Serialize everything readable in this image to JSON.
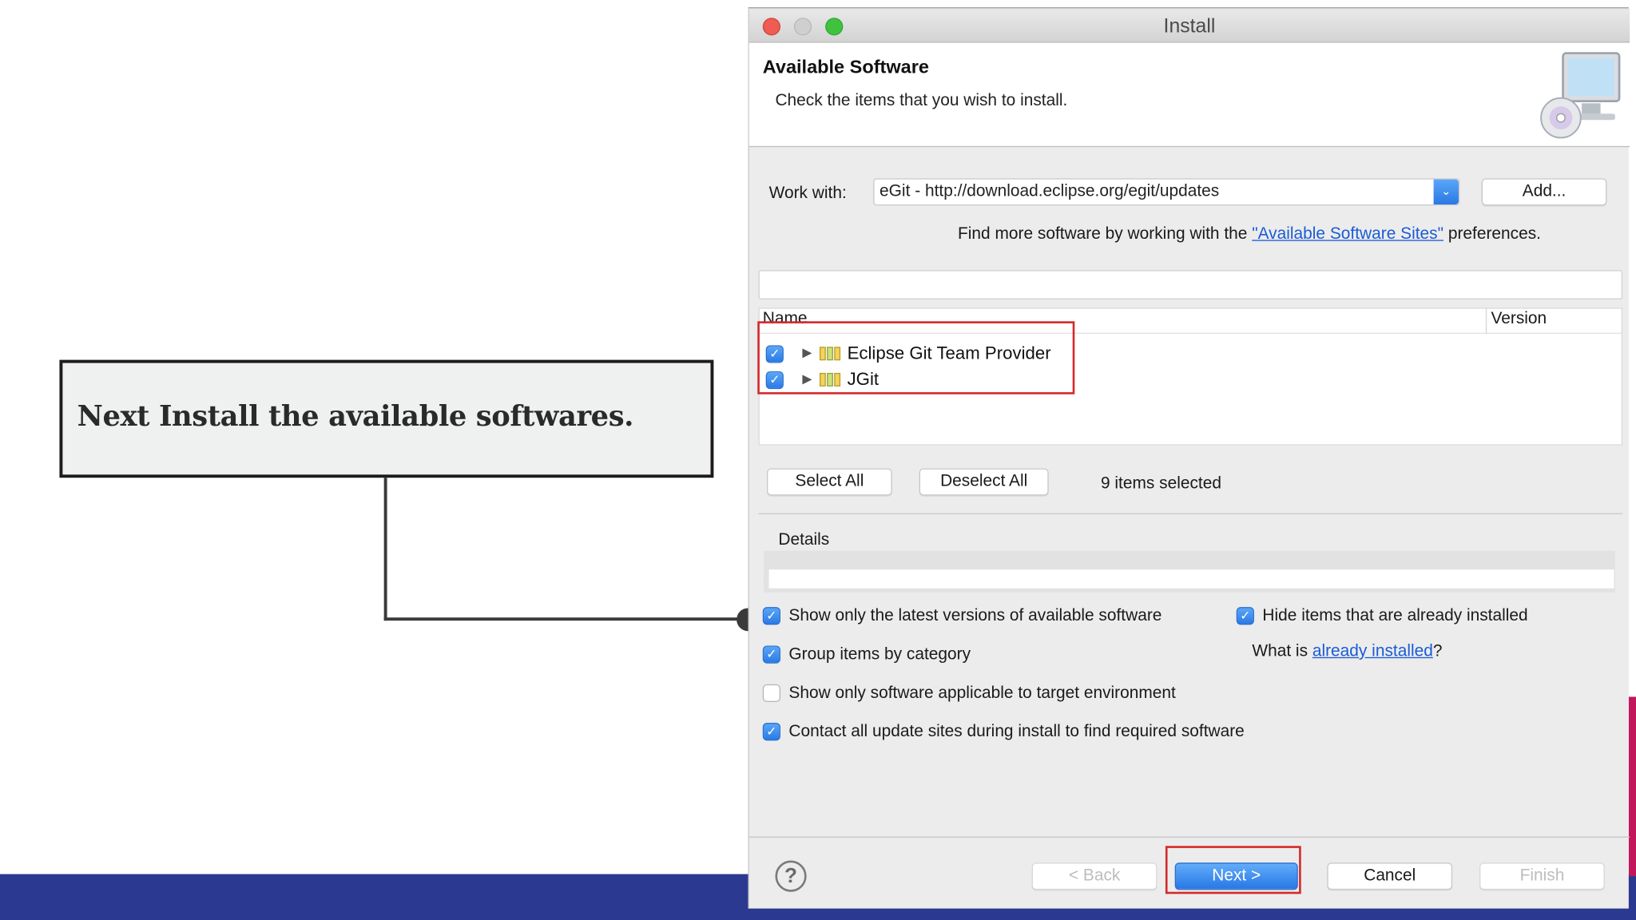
{
  "callout": {
    "text": "Next Install the available softwares."
  },
  "window": {
    "title": "Install"
  },
  "header": {
    "title": "Available Software",
    "subtitle": "Check the items that you wish to install."
  },
  "work_with": {
    "label": "Work with:",
    "value": "eGit - http://download.eclipse.org/egit/updates",
    "add_label": "Add..."
  },
  "find_more": {
    "prefix": "Find more software by working with the ",
    "link": "\"Available Software Sites\"",
    "suffix": " preferences."
  },
  "filter": {
    "value": ""
  },
  "table": {
    "columns": [
      "Name",
      "Version"
    ],
    "rows": [
      {
        "name": "Eclipse Git Team Provider",
        "checked": true
      },
      {
        "name": "JGit",
        "checked": true
      }
    ]
  },
  "selection": {
    "select_all": "Select All",
    "deselect_all": "Deselect All",
    "count": "9 items selected"
  },
  "details": {
    "label": "Details"
  },
  "options": {
    "latest_versions": {
      "label": "Show only the latest versions of available software",
      "checked": true
    },
    "hide_installed": {
      "label": "Hide items that are already installed",
      "checked": true
    },
    "what_is_prefix": "What is ",
    "what_is_link": "already installed",
    "what_is_suffix": "?",
    "group_by_category": {
      "label": "Group items by category",
      "checked": true
    },
    "target_env": {
      "label": "Show only software applicable to target environment",
      "checked": false
    },
    "contact_sites": {
      "label": "Contact all update sites during install to find required software",
      "checked": true
    }
  },
  "footer": {
    "back": "< Back",
    "next": "Next >",
    "cancel": "Cancel",
    "finish": "Finish",
    "help_glyph": "?"
  },
  "icons": {
    "check_glyph": "✓",
    "expand_glyph": "▶",
    "dropdown_glyph": "⌄"
  },
  "colors": {
    "accent_blue": "#2b7ae6",
    "highlight_red": "#d42a2a",
    "slide_band": "#2b3990",
    "slide_accent": "#c2185b"
  }
}
